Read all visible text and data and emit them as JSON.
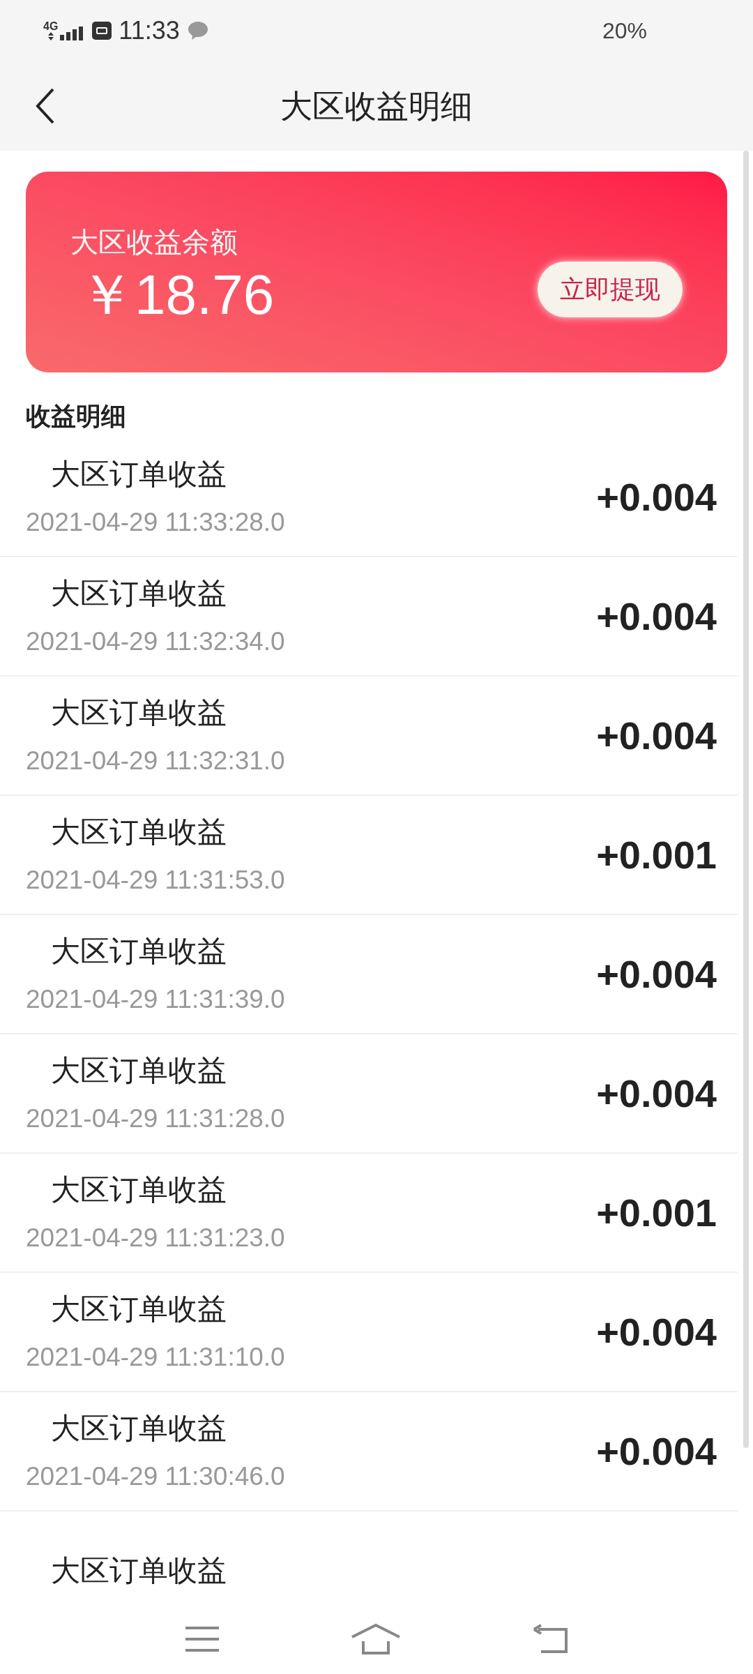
{
  "status_bar": {
    "network": "4G",
    "time": "11:33",
    "battery": "20%"
  },
  "header": {
    "title": "大区收益明细"
  },
  "balance_card": {
    "label": "大区收益余额",
    "amount": "￥18.76",
    "button": "立即提现"
  },
  "section_title": "收益明细",
  "records": [
    {
      "title": "大区订单收益",
      "time": "2021-04-29 11:33:28.0",
      "amount": "+0.004"
    },
    {
      "title": "大区订单收益",
      "time": "2021-04-29 11:32:34.0",
      "amount": "+0.004"
    },
    {
      "title": "大区订单收益",
      "time": "2021-04-29 11:32:31.0",
      "amount": "+0.004"
    },
    {
      "title": "大区订单收益",
      "time": "2021-04-29 11:31:53.0",
      "amount": "+0.001"
    },
    {
      "title": "大区订单收益",
      "time": "2021-04-29 11:31:39.0",
      "amount": "+0.004"
    },
    {
      "title": "大区订单收益",
      "time": "2021-04-29 11:31:28.0",
      "amount": "+0.004"
    },
    {
      "title": "大区订单收益",
      "time": "2021-04-29 11:31:23.0",
      "amount": "+0.001"
    },
    {
      "title": "大区订单收益",
      "time": "2021-04-29 11:31:10.0",
      "amount": "+0.004"
    },
    {
      "title": "大区订单收益",
      "time": "2021-04-29 11:30:46.0",
      "amount": "+0.004"
    },
    {
      "title": "大区订单收益"
    }
  ]
}
